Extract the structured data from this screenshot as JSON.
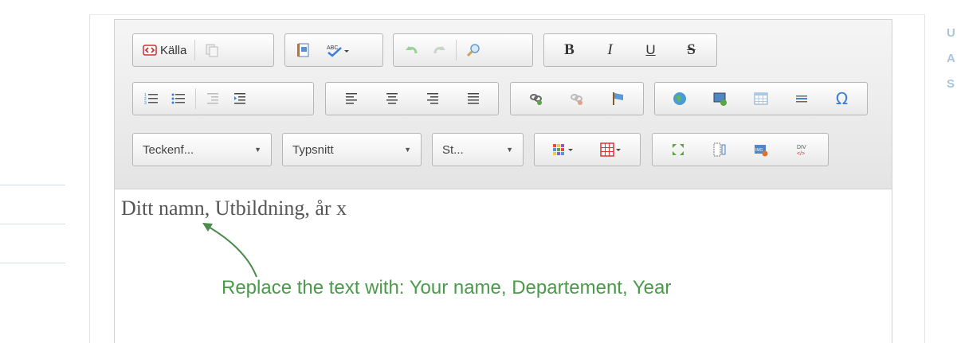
{
  "toolbar": {
    "row1": {
      "source_label": "Källa",
      "bold_label": "B",
      "italic_label": "I",
      "underline_label": "U",
      "strike_label": "S"
    },
    "row3": {
      "font_size_label": "Teckenf...",
      "font_label": "Typsnitt",
      "style_label": "St..."
    }
  },
  "editor": {
    "content_text": "Ditt namn, Utbildning, år x"
  },
  "annotation": {
    "text": "Replace the text with: Your name, Departement, Year",
    "color": "#4a9a4a"
  },
  "right_links": [
    "U",
    "A",
    "S"
  ]
}
